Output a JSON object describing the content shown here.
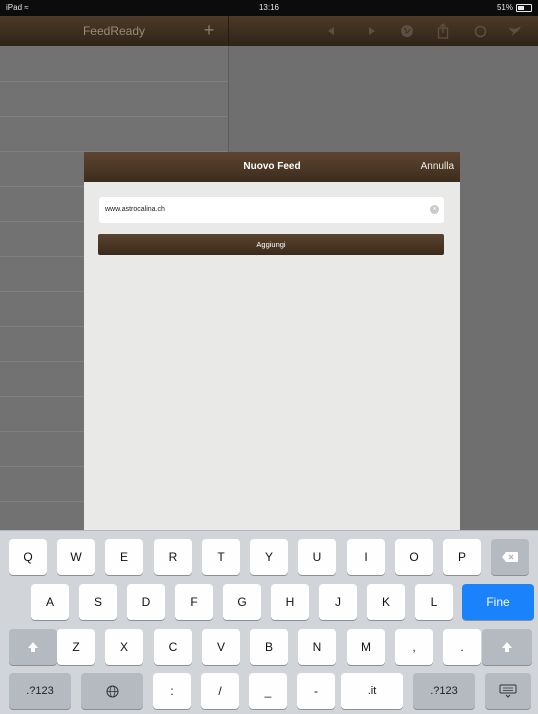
{
  "status_bar": {
    "device": "iPad",
    "time": "13:16",
    "battery": "51%"
  },
  "left_panel": {
    "title": "FeedReady",
    "add_label": "+"
  },
  "right_toolbar": {
    "icons": [
      "back-arrow-icon",
      "forward-arrow-icon",
      "globe-icon",
      "share-icon",
      "refresh-icon",
      "bird-icon"
    ]
  },
  "modal": {
    "title": "Nuovo Feed",
    "cancel_label": "Annulla",
    "url_value": "www.astrocalina.ch",
    "add_button_label": "Aggiungi"
  },
  "keyboard": {
    "row1": [
      "Q",
      "W",
      "E",
      "R",
      "T",
      "Y",
      "U",
      "I",
      "O",
      "P"
    ],
    "row2": [
      "A",
      "S",
      "D",
      "F",
      "G",
      "H",
      "J",
      "K",
      "L"
    ],
    "return_label": "Fine",
    "row3": [
      "Z",
      "X",
      "C",
      "V",
      "B",
      "N",
      "M",
      ",",
      "."
    ],
    "numbers_label": ".?123",
    "row4_keys": [
      ":",
      "/",
      "_",
      "-",
      ".it"
    ],
    "numbers_label_right": ".?123"
  }
}
